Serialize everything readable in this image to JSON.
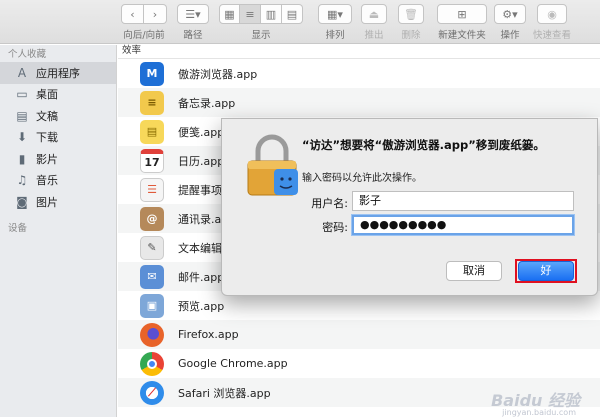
{
  "toolbar": {
    "nav_label": "向后/向前",
    "path_label": "路径",
    "view_label": "显示",
    "arrange_label": "排列",
    "eject_label": "推出",
    "delete_label": "删除",
    "newfolder_label": "新建文件夹",
    "action_label": "操作",
    "quicklook_label": "快速查看"
  },
  "sidebar": {
    "favorites_title": "个人收藏",
    "devices_title": "设备",
    "items": [
      {
        "label": "应用程序",
        "icon": "applications-icon"
      },
      {
        "label": "桌面",
        "icon": "desktop-icon"
      },
      {
        "label": "文稿",
        "icon": "documents-icon"
      },
      {
        "label": "下载",
        "icon": "downloads-icon"
      },
      {
        "label": "影片",
        "icon": "movies-icon"
      },
      {
        "label": "音乐",
        "icon": "music-icon"
      },
      {
        "label": "图片",
        "icon": "pictures-icon"
      }
    ]
  },
  "filelist": {
    "header": "效率",
    "rows": [
      {
        "name": "傲游浏览器.app",
        "icon": "maxthon-icon",
        "color": "#1e6fd6"
      },
      {
        "name": "备忘录.app",
        "icon": "notes-icon",
        "color": "#f2c94c"
      },
      {
        "name": "便笺.app",
        "icon": "stickies-icon",
        "color": "#f7d85a"
      },
      {
        "name": "日历.app",
        "icon": "calendar-icon",
        "color": "#ffffff"
      },
      {
        "name": "提醒事项.",
        "icon": "reminders-icon",
        "color": "#f5f5f5"
      },
      {
        "name": "通讯录.app",
        "icon": "contacts-icon",
        "color": "#b5895a"
      },
      {
        "name": "文本编辑.",
        "icon": "textedit-icon",
        "color": "#e8e8e8"
      },
      {
        "name": "邮件.app",
        "icon": "mail-icon",
        "color": "#5b8fd6"
      },
      {
        "name": "预览.app",
        "icon": "preview-icon",
        "color": "#7ea7d8"
      },
      {
        "name": "Firefox.app",
        "icon": "firefox-icon",
        "color": "#e8632a"
      },
      {
        "name": "Google Chrome.app",
        "icon": "chrome-icon",
        "color": "#34a853"
      },
      {
        "name": "Safari 浏览器.app",
        "icon": "safari-icon",
        "color": "#2f8cea"
      }
    ]
  },
  "dialog": {
    "title": "“访达”想要将“傲游浏览器.app”移到废纸篓。",
    "subtitle": "输入密码以允许此次操作。",
    "username_label": "用户名:",
    "username_value": "影子",
    "password_label": "密码:",
    "password_value": "●●●●●●●●●",
    "cancel_label": "取消",
    "ok_label": "好"
  },
  "watermark": {
    "main": "Baidu 经验",
    "sub": "jingyan.baidu.com"
  }
}
